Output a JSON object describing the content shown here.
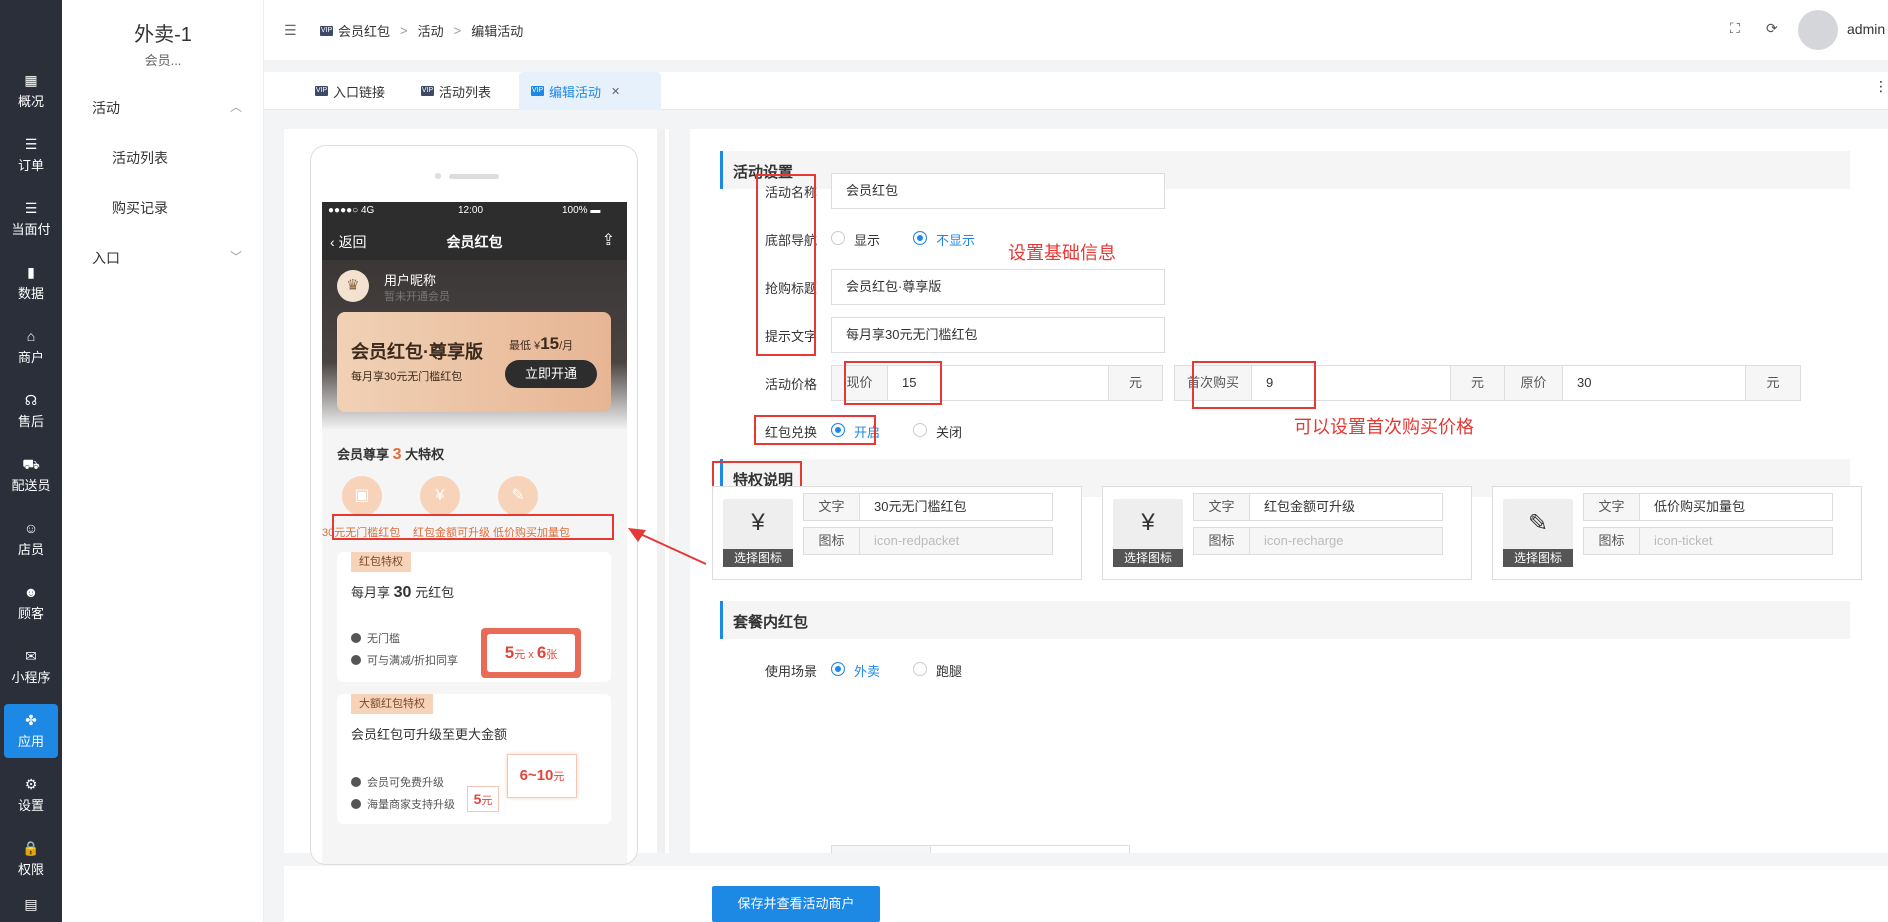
{
  "sidebar": {
    "items": [
      {
        "label": "概况",
        "icon": "dashboard-icon",
        "glyph": "▦"
      },
      {
        "label": "订单",
        "icon": "list-icon",
        "glyph": "☰"
      },
      {
        "label": "当面付",
        "icon": "list-icon",
        "glyph": "☰"
      },
      {
        "label": "数据",
        "icon": "bar-chart-icon",
        "glyph": "▮"
      },
      {
        "label": "商户",
        "icon": "store-icon",
        "glyph": "⌂"
      },
      {
        "label": "售后",
        "icon": "headset-icon",
        "glyph": "☊"
      },
      {
        "label": "配送员",
        "icon": "scooter-icon",
        "glyph": "⛟"
      },
      {
        "label": "店员",
        "icon": "user-icon",
        "glyph": "☺"
      },
      {
        "label": "顾客",
        "icon": "customer-icon",
        "glyph": "☻"
      },
      {
        "label": "小程序",
        "icon": "wechat-icon",
        "glyph": "✉"
      },
      {
        "label": "应用",
        "icon": "apps-icon",
        "glyph": "✤"
      },
      {
        "label": "设置",
        "icon": "settings-icon",
        "glyph": "⚙"
      },
      {
        "label": "权限",
        "icon": "lock-icon",
        "glyph": "🔒"
      },
      {
        "label": "",
        "icon": "report-icon",
        "glyph": "▤"
      }
    ]
  },
  "subnav": {
    "title": "外卖-1",
    "subtitle": "会员...",
    "group1": "活动",
    "leaf1": "活动列表",
    "leaf2": "购买记录",
    "group2": "入口"
  },
  "header": {
    "crumb1": "会员红包",
    "crumb2": "活动",
    "crumb3": "编辑活动",
    "sep": ">",
    "user": "admin ▾"
  },
  "tabs": [
    {
      "label": "入口链接"
    },
    {
      "label": "活动列表"
    },
    {
      "label": "编辑活动"
    }
  ],
  "phone": {
    "status_left": "●●●●○ 4G",
    "status_time": "12:00",
    "status_right": "100% ▬",
    "back": "返回",
    "title": "会员红包",
    "nickname": "用户昵称",
    "not_member": "暂未开通会员",
    "card_title": "会员红包·尊享版",
    "card_sub": "每月享30元无门槛红包",
    "price_prefix": "最低 ¥",
    "price_value": "15",
    "price_suffix": "/月",
    "open_btn": "立即开通",
    "priv_prefix": "会员尊享",
    "priv_count": "3",
    "priv_suffix": "大特权",
    "priv_labels": [
      "30元无门槛红包",
      "红包金额可升级",
      "低价购买加量包"
    ],
    "benefit1": {
      "tag": "红包特权",
      "title_prefix": "每月享",
      "title_amount": "30",
      "title_suffix": "元红包",
      "check1": "无门槛",
      "check2": "可与满减/折扣同享",
      "coupon_amount": "5",
      "coupon_unit": "元 x",
      "coupon_count": "6",
      "coupon_count_unit": "张"
    },
    "benefit2": {
      "tag": "大额红包特权",
      "title": "会员红包可升级至更大金额",
      "check1": "会员可免费升级",
      "check2": "海量商家支持升级",
      "from_amount": "5",
      "from_unit": "元",
      "to_amount": "6~10",
      "to_unit": "元"
    }
  },
  "form": {
    "section1": "活动设置",
    "name_label": "活动名称",
    "name_value": "会员红包",
    "nav_label": "底部导航",
    "nav_show": "显示",
    "nav_hide": "不显示",
    "grab_label": "抢购标题",
    "grab_value": "会员红包·尊享版",
    "tip_label": "提示文字",
    "tip_value": "每月享30元无门槛红包",
    "price_label": "活动价格",
    "cur_addon": "现价",
    "cur_value": "15",
    "yuan": "元",
    "first_addon": "首次购买",
    "first_value": "9",
    "orig_addon": "原价",
    "orig_value": "30",
    "exchange_label": "红包兑换",
    "ex_on": "开启",
    "ex_off": "关闭",
    "section2": "特权说明",
    "text_label": "文字",
    "icon_label": "图标",
    "choose_icon": "选择图标",
    "priv_cards": [
      {
        "text": "30元无门槛红包",
        "icon": "icon-redpacket",
        "glyph": "¥"
      },
      {
        "text": "红包金额可升级",
        "icon": "icon-recharge",
        "glyph": "¥"
      },
      {
        "text": "低价购买加量包",
        "icon": "icon-ticket",
        "glyph": "✎"
      }
    ],
    "section3": "套餐内红包",
    "scene_label": "使用场景",
    "scene_a": "外卖",
    "scene_b": "跑腿",
    "save": "保存并查看活动商户"
  },
  "annotations": {
    "basic": "设置基础信息",
    "first_price": "可以设置首次购买价格"
  },
  "colors": {
    "accent": "#1e88e5",
    "sidebar_bg": "#2a2f3a",
    "highlight": "#e53935",
    "gold": "#e06d3b"
  }
}
